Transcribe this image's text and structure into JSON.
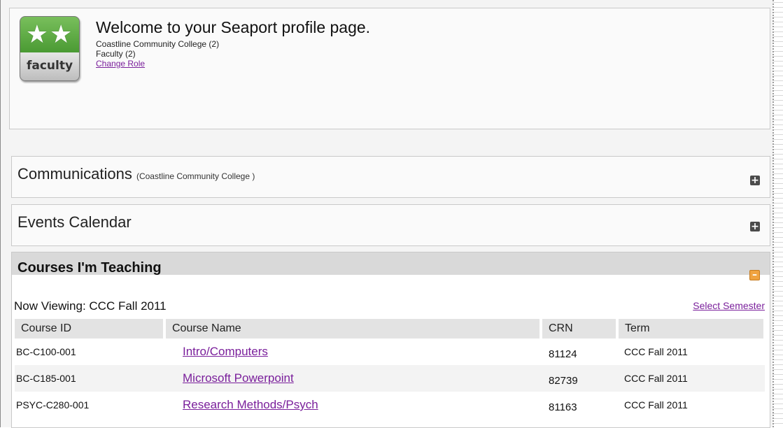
{
  "profile": {
    "badge_label": "faculty",
    "welcome": "Welcome to your Seaport profile page.",
    "college": "Coastline Community College (2)",
    "role": "Faculty (2)",
    "change_role": "Change Role"
  },
  "communications": {
    "title": "Communications",
    "subtitle": "(Coastline Community College )"
  },
  "events": {
    "title": "Events Calendar"
  },
  "courses": {
    "title": "Courses I'm Teaching",
    "now_viewing": "Now Viewing: CCC Fall 2011",
    "select_semester": "Select Semester",
    "columns": [
      "Course ID",
      "Course Name",
      "CRN",
      "Term"
    ],
    "rows": [
      {
        "id": "BC-C100-001",
        "name": "Intro/Computers",
        "crn": "81124",
        "term": "CCC Fall 2011"
      },
      {
        "id": "BC-C185-001",
        "name": "Microsoft Powerpoint",
        "crn": "82739",
        "term": "CCC Fall 2011"
      },
      {
        "id": "PSYC-C280-001",
        "name": "Research Methods/Psych",
        "crn": "81163",
        "term": "CCC Fall 2011"
      }
    ]
  },
  "colors": {
    "link": "#7a1f9b",
    "badge_green": "#4a9a33",
    "collapse_toggle": "#f0a341"
  }
}
